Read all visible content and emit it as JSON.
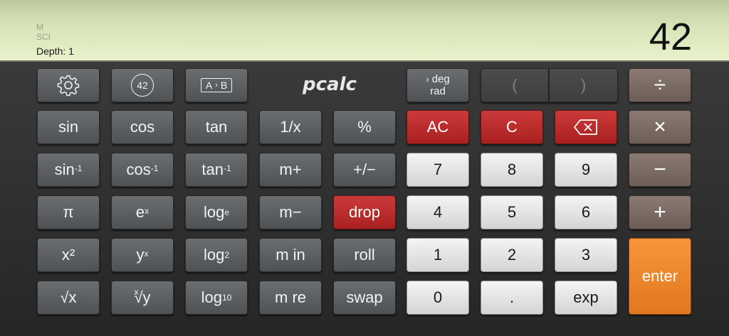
{
  "display": {
    "indicator_m": "M",
    "indicator_sci": "SCI",
    "depth_label": "Depth: 1",
    "readout": "42"
  },
  "logo": "pcalc",
  "icons": {
    "settings": "gear-icon",
    "constants": "circle-42-icon",
    "conversions": "a-to-b-icon",
    "backspace": "backspace-icon"
  },
  "keys": {
    "constants_label": "42",
    "convert_a": "A",
    "convert_b": "B",
    "deg": "deg",
    "rad": "rad",
    "open_paren": "(",
    "close_paren": ")",
    "divide": "÷",
    "sin": "sin",
    "cos": "cos",
    "tan": "tan",
    "reciprocal": "1/x",
    "percent": "%",
    "ac": "AC",
    "c": "C",
    "multiply": "×",
    "asin_base": "sin",
    "acos_base": "cos",
    "atan_base": "tan",
    "inverse_sup": "-1",
    "m_plus": "m+",
    "plus_minus": "+/−",
    "seven": "7",
    "eight": "8",
    "nine": "9",
    "minus": "−",
    "pi": "π",
    "e_base": "e",
    "x_sup": "x",
    "log": "log",
    "log_e_sub": "e",
    "m_minus": "m−",
    "drop": "drop",
    "four": "4",
    "five": "5",
    "six": "6",
    "plus": "+",
    "x_squared": "x²",
    "y_base": "y",
    "log_2_sub": "2",
    "m_in": "m in",
    "roll": "roll",
    "one": "1",
    "two": "2",
    "three": "3",
    "enter": "enter",
    "sqrt": "√x",
    "root_index": "x",
    "root_y": "√y",
    "log_10_sub": "10",
    "m_re": "m re",
    "swap": "swap",
    "zero": "0",
    "dot": ".",
    "exp": "exp"
  }
}
